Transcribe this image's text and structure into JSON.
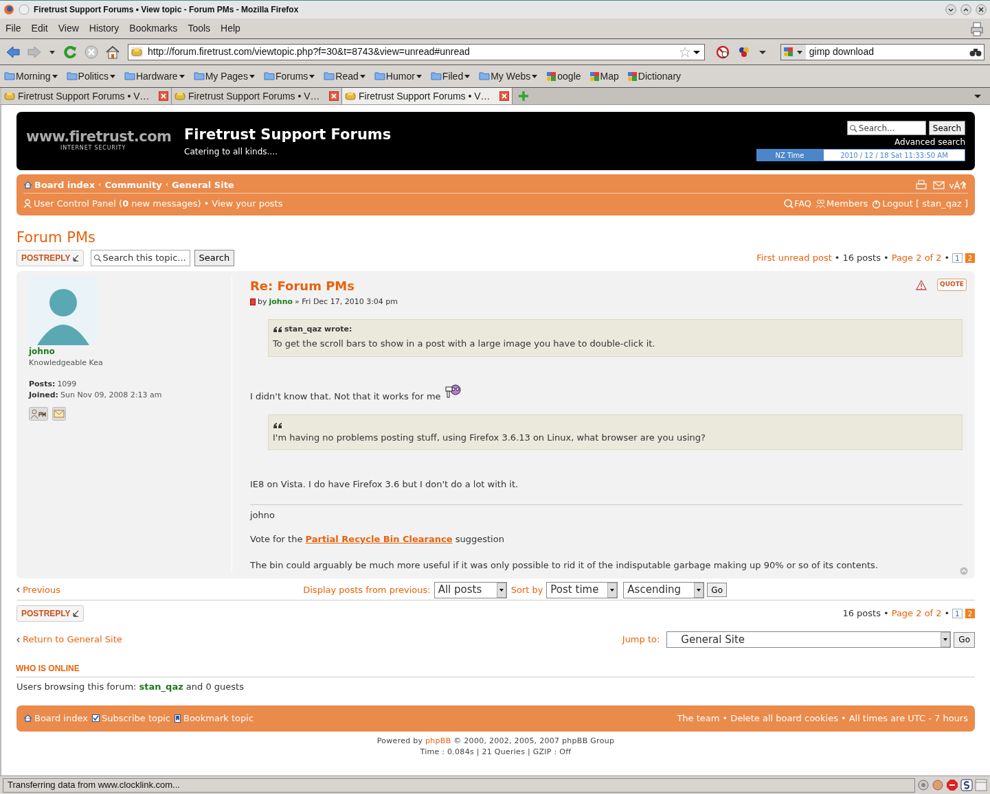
{
  "window": {
    "title": "Firetrust Support Forums • View topic - Forum PMs - Mozilla Firefox"
  },
  "menu": [
    "File",
    "Edit",
    "View",
    "History",
    "Bookmarks",
    "Tools",
    "Help"
  ],
  "navigation": {
    "url": "http://forum.firetrust.com/viewtopic.php?f=30&t=8743&view=unread#unread",
    "search": "gimp download"
  },
  "bookmarks": [
    {
      "label": "Morning",
      "kind": "folder"
    },
    {
      "label": "Politics",
      "kind": "folder"
    },
    {
      "label": "Hardware",
      "kind": "folder"
    },
    {
      "label": "My Pages",
      "kind": "folder"
    },
    {
      "label": "Forums",
      "kind": "folder"
    },
    {
      "label": "Read",
      "kind": "folder"
    },
    {
      "label": "Humor",
      "kind": "folder"
    },
    {
      "label": "Filed",
      "kind": "folder"
    },
    {
      "label": "My Webs",
      "kind": "folder"
    },
    {
      "label": "oogle",
      "kind": "google"
    },
    {
      "label": "Map",
      "kind": "google"
    },
    {
      "label": "Dictionary",
      "kind": "google"
    }
  ],
  "tabs": [
    {
      "label": "Firetrust Support Forums • V…",
      "selected": false
    },
    {
      "label": "Firetrust Support Forums • V…",
      "selected": false
    },
    {
      "label": "Firetrust Support Forums • V…",
      "selected": true
    }
  ],
  "header": {
    "logo_main": "www.firetrust.com",
    "logo_sub": "INTERNET SECURITY",
    "title": "Firetrust Support Forums",
    "tagline": "Catering to all kinds....",
    "search_placeholder": "Search...",
    "search_button": "Search",
    "advanced_search": "Advanced search",
    "time_label": "NZ Time",
    "time_value": "2010 / 12 / 18 Sat  11:33:50 AM"
  },
  "navbar": {
    "breadcrumbs": [
      "Board index",
      "Community",
      "General Site"
    ],
    "breadcrumb_separators": [
      "‹",
      "‹"
    ],
    "bullet": "•",
    "ucp": "User Control Panel (**0** new messages)",
    "view_posts": "View your posts",
    "faq": "FAQ",
    "members": "Members",
    "logout": "Logout [ stan_qaz ]"
  },
  "topic": {
    "title": "Forum PMs",
    "post_reply": "POSTREPLY",
    "search_placeholder": "Search this topic...",
    "search_button": "Search",
    "first_unread": "First unread post",
    "post_count": "16 posts",
    "page_label": "Page 2 of 2",
    "bullets": [
      "•",
      "•",
      "•"
    ],
    "pages": [
      {
        "label": "1",
        "selected": false
      },
      {
        "label": "2",
        "selected": true
      }
    ]
  },
  "post": {
    "title": "Re: Forum PMs",
    "by": "by",
    "author": "johno",
    "date": "» Fri Dec 17, 2010 3:04 pm",
    "quote_button": "QUOTE",
    "profile": {
      "name": "johno",
      "rank": "Knowledgeable Kea",
      "posts_label": "Posts:",
      "posts": "1099",
      "joined_label": "Joined:",
      "joined": "Sun Nov 09, 2008 2:13 am"
    },
    "content": [
      {
        "kind": "quote",
        "author": "stan_qaz wrote:",
        "text": "To get the scroll bars to show in a post with a large image you have to double-click it."
      },
      {
        "kind": "smiley_text",
        "text": "I didn't know that. Not that it works for me"
      },
      {
        "kind": "quote",
        "text": "I'm having no problems posting stuff, using Firefox 3.6.13 on Linux, what browser are you using?"
      },
      {
        "kind": "text",
        "text": "IE8 on Vista. I do have Firefox 3.6 but I don't do a lot with it."
      }
    ],
    "signature": {
      "name": "johno",
      "vote_before": "Vote for the",
      "vote_link": "Partial Recycle Bin Clearance",
      "vote_after": "suggestion",
      "text": "The bin could arguably be much more useful if it was only possible to rid it of the indisputable garbage making up 90% or so of its contents."
    }
  },
  "display": {
    "previous": "Previous",
    "display_label": "Display posts from previous:",
    "range": "All posts",
    "sort_label": "Sort by",
    "sort_key": "Post time",
    "direction": "Ascending",
    "go": "Go"
  },
  "bottom": {
    "post_reply": "POSTREPLY",
    "post_count": "16 posts",
    "page_label": "Page 2 of 2",
    "bullets": [
      "•",
      "•"
    ],
    "pages": [
      {
        "label": "1",
        "selected": false
      },
      {
        "label": "2",
        "selected": true
      }
    ],
    "return": "Return to General Site",
    "jump_label": "Jump to:",
    "jump_value": "General Site",
    "go": "Go"
  },
  "online": {
    "heading": "WHO IS ONLINE",
    "before": "Users browsing this forum:",
    "user": "stan_qaz",
    "after": "and 0 guests"
  },
  "footer": {
    "board_index": "Board index",
    "subscribe": "Subscribe topic",
    "subscribed": true,
    "bookmark": "Bookmark topic",
    "team": "The team",
    "bullets": [
      "•",
      "•"
    ],
    "delete_cookies": "Delete all board cookies",
    "times": "All times are UTC - 7 hours"
  },
  "credits": {
    "powered_before": "Powered by",
    "powered_link": "phpBB",
    "powered_after": "© 2000, 2002, 2005, 2007 phpBB Group",
    "stats": "Time : 0.084s | 21 Queries | GZIP : Off"
  },
  "status_bar": {
    "text": "Transferring data from www.clocklink.com..."
  }
}
